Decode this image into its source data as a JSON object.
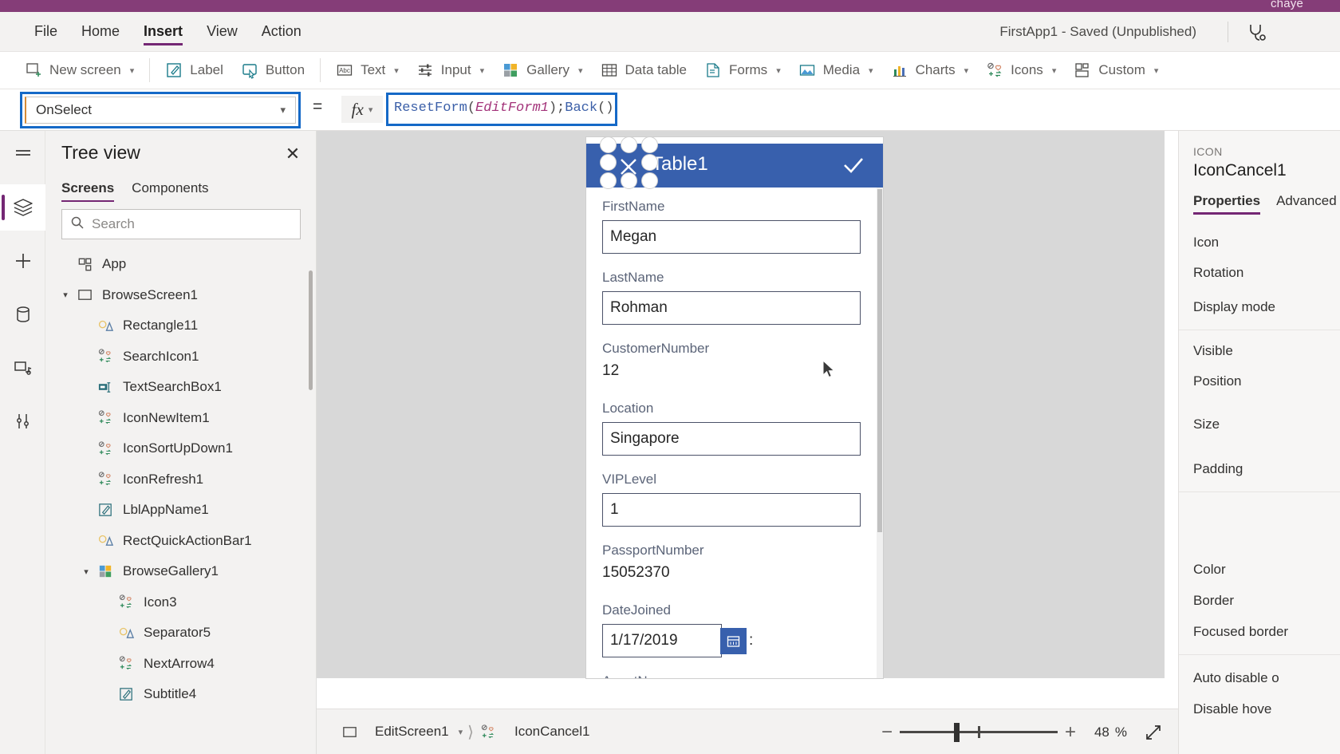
{
  "titlebar": {
    "clipped_text": "chaye",
    "app_status": "FirstApp1 - Saved (Unpublished)",
    "health_icon": "stethoscope-icon"
  },
  "menubar": {
    "items": [
      {
        "label": "File",
        "active": false
      },
      {
        "label": "Home",
        "active": false
      },
      {
        "label": "Insert",
        "active": true
      },
      {
        "label": "View",
        "active": false
      },
      {
        "label": "Action",
        "active": false
      }
    ]
  },
  "ribbon": {
    "groups": [
      {
        "buttons": [
          {
            "label": "New screen",
            "icon": "new-screen-icon",
            "caret": true
          }
        ]
      },
      {
        "buttons": [
          {
            "label": "Label",
            "icon": "label-icon",
            "caret": false
          },
          {
            "label": "Button",
            "icon": "button-icon",
            "caret": false
          }
        ]
      },
      {
        "buttons": [
          {
            "label": "Text",
            "icon": "text-abc-icon",
            "caret": true
          },
          {
            "label": "Input",
            "icon": "input-sliders-icon",
            "caret": true
          },
          {
            "label": "Gallery",
            "icon": "gallery-icon",
            "caret": true
          },
          {
            "label": "Data table",
            "icon": "data-table-icon",
            "caret": false
          },
          {
            "label": "Forms",
            "icon": "forms-icon",
            "caret": true
          },
          {
            "label": "Media",
            "icon": "media-image-icon",
            "caret": true
          },
          {
            "label": "Charts",
            "icon": "charts-bar-icon",
            "caret": true
          },
          {
            "label": "Icons",
            "icon": "icons-shapes-icon",
            "caret": true
          },
          {
            "label": "Custom",
            "icon": "custom-grid-icon",
            "caret": true
          }
        ]
      }
    ]
  },
  "formula_bar": {
    "property": "OnSelect",
    "equals": "=",
    "fx_label": "fx",
    "formula_tokens": [
      {
        "text": "ResetForm",
        "type": "fn"
      },
      {
        "text": "(",
        "type": "pn"
      },
      {
        "text": "EditForm1",
        "type": "id"
      },
      {
        "text": ");",
        "type": "pn"
      },
      {
        "text": "Back",
        "type": "fn"
      },
      {
        "text": "()",
        "type": "pn"
      }
    ],
    "formula_plain": "ResetForm(EditForm1);Back()"
  },
  "rail": {
    "items": [
      {
        "name": "hamburger-menu-icon",
        "active": false
      },
      {
        "name": "tree-view-layers-icon",
        "active": true
      },
      {
        "name": "insert-plus-icon",
        "active": false
      },
      {
        "name": "data-sources-icon",
        "active": false
      },
      {
        "name": "media-library-icon",
        "active": false
      },
      {
        "name": "advanced-tools-icon",
        "active": false
      }
    ]
  },
  "treeview": {
    "title": "Tree view",
    "close_icon": "close-icon",
    "tabs": [
      {
        "label": "Screens",
        "active": true
      },
      {
        "label": "Components",
        "active": false
      }
    ],
    "search": {
      "placeholder": "Search",
      "value": "",
      "icon": "search-icon"
    },
    "nodes": [
      {
        "label": "App",
        "icon": "app-icon",
        "depth": 0,
        "caret": ""
      },
      {
        "label": "BrowseScreen1",
        "icon": "screen-icon",
        "depth": 0,
        "caret": "down"
      },
      {
        "label": "Rectangle11",
        "icon": "shape-icon",
        "depth": 1,
        "caret": ""
      },
      {
        "label": "SearchIcon1",
        "icon": "icon-control-icon",
        "depth": 1,
        "caret": ""
      },
      {
        "label": "TextSearchBox1",
        "icon": "textinput-icon",
        "depth": 1,
        "caret": ""
      },
      {
        "label": "IconNewItem1",
        "icon": "icon-control-icon",
        "depth": 1,
        "caret": ""
      },
      {
        "label": "IconSortUpDown1",
        "icon": "icon-control-icon",
        "depth": 1,
        "caret": ""
      },
      {
        "label": "IconRefresh1",
        "icon": "icon-control-icon",
        "depth": 1,
        "caret": ""
      },
      {
        "label": "LblAppName1",
        "icon": "label-control-icon",
        "depth": 1,
        "caret": ""
      },
      {
        "label": "RectQuickActionBar1",
        "icon": "shape-icon",
        "depth": 1,
        "caret": ""
      },
      {
        "label": "BrowseGallery1",
        "icon": "gallery-control-icon",
        "depth": 1,
        "caret": "down"
      },
      {
        "label": "Icon3",
        "icon": "icon-control-icon",
        "depth": 2,
        "caret": ""
      },
      {
        "label": "Separator5",
        "icon": "shape-icon",
        "depth": 2,
        "caret": ""
      },
      {
        "label": "NextArrow4",
        "icon": "icon-control-icon",
        "depth": 2,
        "caret": ""
      },
      {
        "label": "Subtitle4",
        "icon": "label-control-icon",
        "depth": 2,
        "caret": ""
      }
    ]
  },
  "canvas": {
    "form": {
      "header_title": "Table1",
      "header_cancel_icon": "cancel-x-icon",
      "header_check_icon": "checkmark-icon",
      "fields": [
        {
          "label": "FirstName",
          "value": "Megan",
          "kind": "input"
        },
        {
          "label": "LastName",
          "value": "Rohman",
          "kind": "input"
        },
        {
          "label": "CustomerNumber",
          "value": "12",
          "kind": "static"
        },
        {
          "label": "Location",
          "value": "Singapore",
          "kind": "input"
        },
        {
          "label": "VIPLevel",
          "value": "1",
          "kind": "input"
        },
        {
          "label": "PassportNumber",
          "value": "15052370",
          "kind": "static"
        },
        {
          "label": "DateJoined",
          "value": "1/17/2019",
          "kind": "date",
          "suffix": ":",
          "picker_icon": "calendar-icon"
        },
        {
          "label": "AgentName",
          "value": "",
          "kind": "label-only"
        }
      ]
    },
    "cursor_icon": "mouse-pointer-icon"
  },
  "properties_panel": {
    "kicker": "ICON",
    "control_name": "IconCancel1",
    "tabs": [
      {
        "label": "Properties",
        "active": true
      },
      {
        "label": "Advanced",
        "active": false
      }
    ],
    "groups": [
      {
        "rows": [
          "Icon",
          "Rotation",
          "Display mode"
        ]
      },
      {
        "rows": [
          "Visible",
          "Position",
          "Size",
          "Padding"
        ]
      },
      {
        "rows": [
          "Color",
          "Border",
          "Focused border"
        ]
      },
      {
        "rows": [
          "Auto disable o",
          "Disable hove"
        ]
      }
    ]
  },
  "statusbar": {
    "breadcrumb": [
      {
        "label": "EditScreen1",
        "icon": "screen-icon",
        "caret": true
      },
      {
        "label": "IconCancel1",
        "icon": "icon-control-icon",
        "caret": false
      }
    ],
    "zoom": {
      "minus_label": "−",
      "plus_label": "+",
      "value": "48",
      "percent": "%",
      "expand_icon": "fit-screen-icon"
    }
  },
  "colors": {
    "brand_purple": "#853d78",
    "accent_purple": "#742774",
    "selection_blue": "#1569c7",
    "form_header_blue": "#3860ad",
    "chrome_gray": "#f3f2f1",
    "canvas_gray": "#d8d8d8"
  }
}
